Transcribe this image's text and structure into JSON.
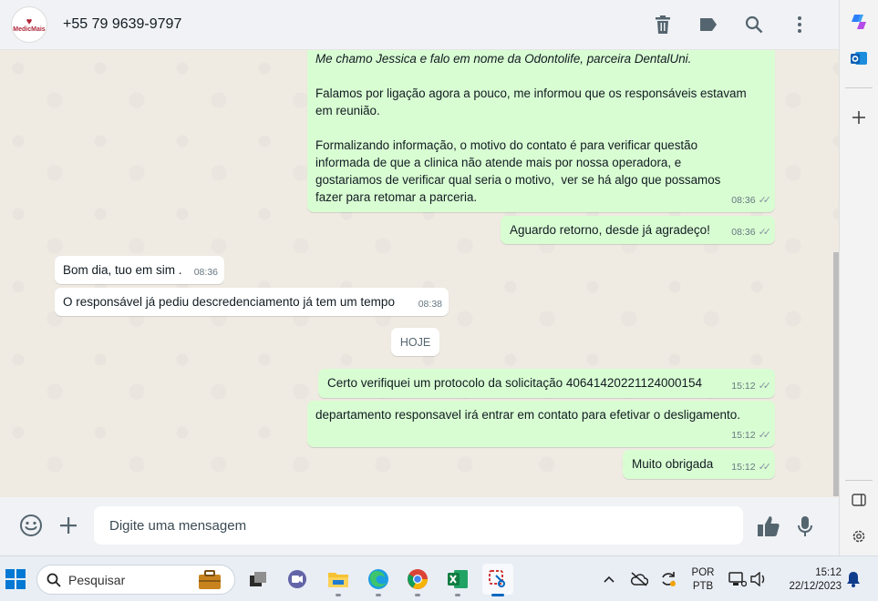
{
  "header": {
    "contact_name": "+55 79 9639-9797",
    "avatar_text": "MedicMais",
    "actions": [
      "delete-icon",
      "label-icon",
      "search-icon",
      "menu-icon"
    ]
  },
  "messages": {
    "m1": {
      "text": "Me chamo Jessica e falo em nome da Odontolife, parceira DentalUni.\n\nFalamos por ligação agora a pouco, me informou que os responsáveis estavam\nem reunião.\n\nFormalizando informação, o motivo do contato é para verificar questão\ninformada de que a clinica não atende mais por nossa operadora, e\ngostariamos de verificar qual seria o motivo,  ver se há algo que possamos\nfazer para retomar a parceria.",
      "time": "08:36"
    },
    "m2": {
      "text": "Aguardo retorno, desde já agradeço!",
      "time": "08:36"
    },
    "m3": {
      "text": "Bom dia, tuo em sim .",
      "time": "08:36"
    },
    "m4": {
      "text": "O responsável já pediu descredenciamento já tem um tempo",
      "time": "08:38"
    },
    "day": "HOJE",
    "m5": {
      "text": "Certo verifiquei um protocolo da solicitação 40641420221124000154",
      "time": "15:12"
    },
    "m6": {
      "text": "departamento responsavel irá entrar em contato para efetivar o desligamento.",
      "time": "15:12"
    },
    "m7": {
      "text": "Muito obrigada",
      "time": "15:12"
    }
  },
  "composer": {
    "placeholder": "Digite uma mensagem"
  },
  "taskbar": {
    "search_label": "Pesquisar",
    "lang_top": "POR",
    "lang_bottom": "PTB",
    "clock_time": "15:12",
    "clock_date": "22/12/2023"
  },
  "colors": {
    "outgoing": "#d9fdd3",
    "incoming": "#ffffff",
    "chat_bg": "#efeae2",
    "header_bg": "#f0f2f5"
  }
}
